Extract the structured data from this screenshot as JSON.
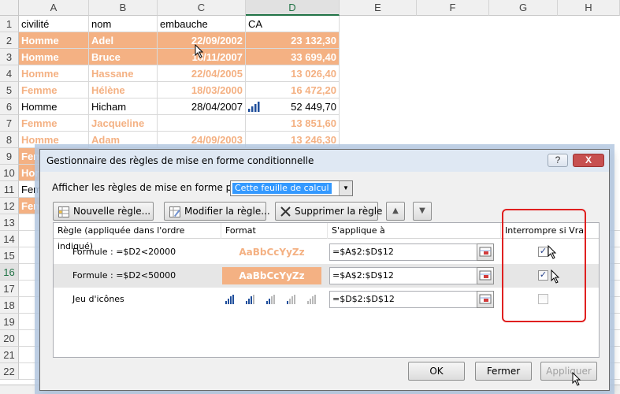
{
  "sheet": {
    "columns": [
      "A",
      "B",
      "C",
      "D",
      "E",
      "F",
      "G",
      "H"
    ],
    "selected_column": "D",
    "row_numbers": [
      "1",
      "2",
      "3",
      "4",
      "5",
      "6",
      "7",
      "8",
      "9",
      "10",
      "11",
      "12",
      "13",
      "14",
      "15",
      "16",
      "17",
      "18",
      "19",
      "20",
      "21",
      "22"
    ],
    "selected_row": "16",
    "header_row": [
      "civilité",
      "nom",
      "embauche",
      "CA"
    ],
    "rows": [
      {
        "civ": "Homme",
        "nom": "Adel",
        "date": "22/09/2002",
        "ca": "23 132,30"
      },
      {
        "civ": "Homme",
        "nom": "Bruce",
        "date": "18/11/2007",
        "ca": "33 699,40"
      },
      {
        "civ": "Homme",
        "nom": "Hassane",
        "date": "22/04/2005",
        "ca": "13 026,40"
      },
      {
        "civ": "Femme",
        "nom": "Hélène",
        "date": "18/03/2000",
        "ca": "16 472,20"
      },
      {
        "civ": "Homme",
        "nom": "Hicham",
        "date": "28/04/2007",
        "ca": "52 449,70"
      },
      {
        "civ": "Femme",
        "nom": "Jacqueline",
        "date": "",
        "ca": "13 851,60"
      },
      {
        "civ": "Homme",
        "nom": "Adam",
        "date": "24/09/2003",
        "ca": "13 246,30"
      },
      {
        "civ": "Fem",
        "nom": "",
        "date": "",
        "ca": ""
      },
      {
        "civ": "Hor",
        "nom": "",
        "date": "",
        "ca": ""
      },
      {
        "civ": "Fem",
        "nom": "",
        "date": "",
        "ca": ""
      },
      {
        "civ": "Fem",
        "nom": "",
        "date": "",
        "ca": ""
      }
    ]
  },
  "dialog": {
    "title": "Gestionnaire des règles de mise en forme conditionnelle",
    "help_label": "?",
    "close_label": "X",
    "show_rules_label": "Afficher les règles de mise en forme pour :",
    "show_rules_value": "Cette feuille de calcul",
    "buttons": {
      "new_rule": "Nouvelle règle...",
      "edit_rule": "Modifier la règle...",
      "delete_rule": "Supprimer la règle",
      "ok": "OK",
      "close": "Fermer",
      "apply": "Appliquer"
    },
    "columns": {
      "rule": "Règle (appliquée dans l'ordre indiqué)",
      "format": "Format",
      "applies_to": "S'applique à",
      "stop_if_true": "Interrompre si Vrai"
    },
    "rules": [
      {
        "rule": "Formule : =$D2<20000",
        "format": "AaBbCcYyZz",
        "applies": "=$A$2:$D$12",
        "stop": true
      },
      {
        "rule": "Formule : =$D2<50000",
        "format": "AaBbCcYyZz",
        "applies": "=$A$2:$D$12",
        "stop": true
      },
      {
        "rule": "Jeu d'icônes",
        "format": "",
        "applies": "=$D$2:$D$12",
        "stop": false
      }
    ]
  },
  "colors": {
    "fill": "#f4b183",
    "highlight": "#e02020",
    "selection": "#3399ff"
  }
}
